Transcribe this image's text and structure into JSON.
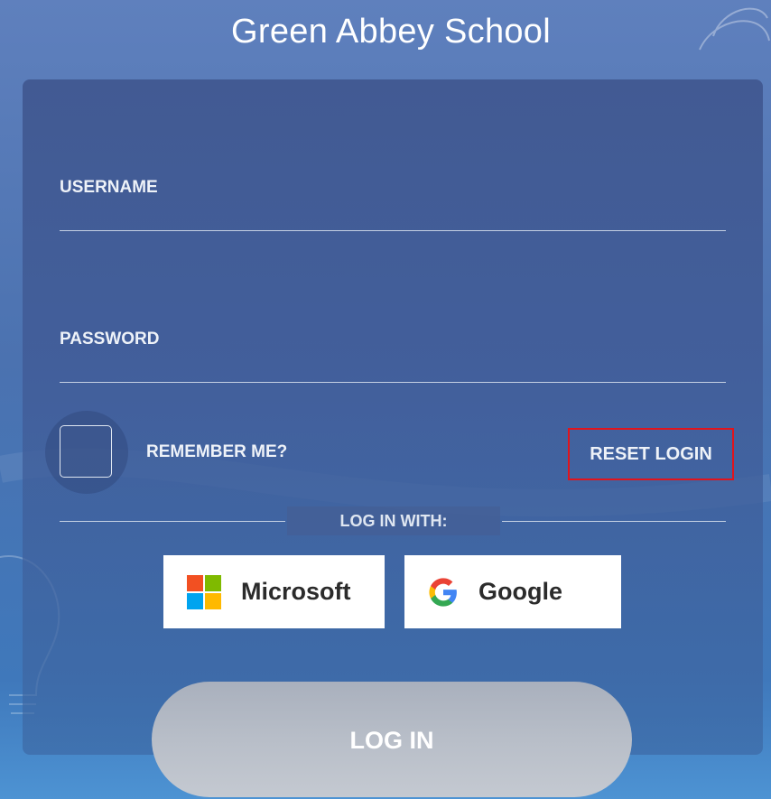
{
  "header": {
    "title": "Green Abbey School"
  },
  "form": {
    "username_label": "USERNAME",
    "password_label": "PASSWORD",
    "remember_label": "REMEMBER ME?",
    "reset_label": "RESET LOGIN",
    "login_with_label": "LOG IN WITH:",
    "login_button_label": "LOG IN"
  },
  "sso": {
    "microsoft_label": "Microsoft",
    "google_label": "Google"
  },
  "colors": {
    "background": "#4b72b0",
    "panel": "#3e548c",
    "reset_highlight": "#e1141c",
    "login_button": "#b8bec8",
    "microsoft": [
      "#f25022",
      "#7fba00",
      "#00a4ef",
      "#ffb900"
    ],
    "google": [
      "#4285f4",
      "#ea4335",
      "#fbbc05",
      "#34a853"
    ]
  },
  "icons": [
    "watermark-swirl-icon",
    "lightbulb-icon",
    "microsoft-logo-icon",
    "google-logo-icon"
  ]
}
